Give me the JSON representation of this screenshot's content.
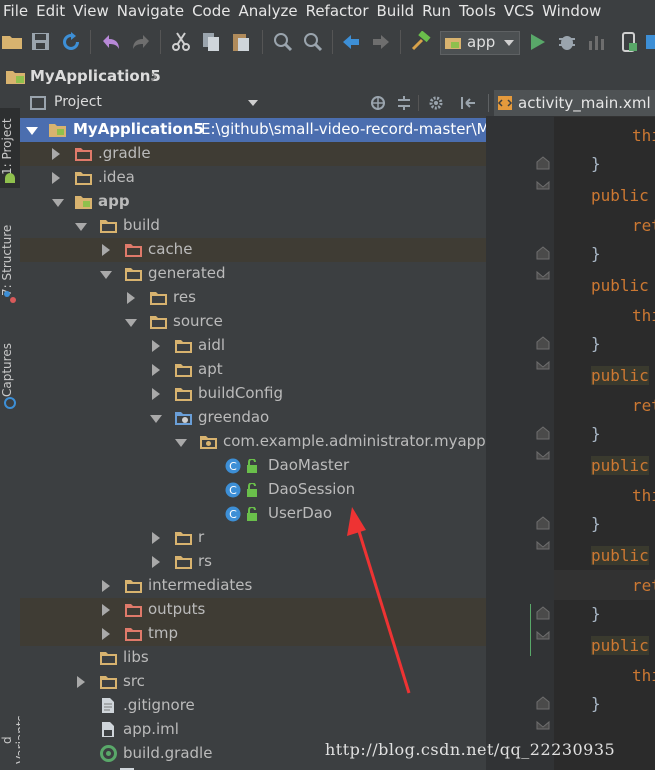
{
  "menubar": {
    "items": [
      "File",
      "Edit",
      "View",
      "Navigate",
      "Code",
      "Analyze",
      "Refactor",
      "Build",
      "Run",
      "Tools",
      "VCS",
      "Window"
    ]
  },
  "toolbar": {
    "run_config": "app"
  },
  "navbar": {
    "breadcrumb": "MyApplication5"
  },
  "sidebar": {
    "project_tab": "1: Project",
    "structure_tab": "7: Structure",
    "captures_tab": "Captures",
    "variants_tab": "d Variants"
  },
  "panel": {
    "title": "Project"
  },
  "tree": {
    "rows": [
      {
        "label": "MyApplication5",
        "path": "E:\\github\\small-video-record-master\\M",
        "icon": "module-folder-icon"
      },
      {
        "label": ".gradle",
        "icon": "folder-excluded-icon"
      },
      {
        "label": ".idea",
        "icon": "folder-icon"
      },
      {
        "label": "app",
        "icon": "module-folder-icon"
      },
      {
        "label": "build",
        "icon": "folder-icon"
      },
      {
        "label": "cache",
        "icon": "folder-excluded-icon"
      },
      {
        "label": "generated",
        "icon": "folder-icon"
      },
      {
        "label": "res",
        "icon": "folder-icon"
      },
      {
        "label": "source",
        "icon": "folder-icon"
      },
      {
        "label": "aidl",
        "icon": "folder-icon"
      },
      {
        "label": "apt",
        "icon": "folder-icon"
      },
      {
        "label": "buildConfig",
        "icon": "folder-icon"
      },
      {
        "label": "greendao",
        "icon": "source-folder-icon"
      },
      {
        "label": "com.example.administrator.myappli",
        "icon": "package-icon"
      },
      {
        "label": "DaoMaster",
        "icon": "class-icon"
      },
      {
        "label": "DaoSession",
        "icon": "class-icon"
      },
      {
        "label": "UserDao",
        "icon": "class-icon"
      },
      {
        "label": "r",
        "icon": "folder-icon"
      },
      {
        "label": "rs",
        "icon": "folder-icon"
      },
      {
        "label": "intermediates",
        "icon": "folder-icon"
      },
      {
        "label": "outputs",
        "icon": "folder-excluded-icon"
      },
      {
        "label": "tmp",
        "icon": "folder-excluded-icon"
      },
      {
        "label": "libs",
        "icon": "folder-icon"
      },
      {
        "label": "src",
        "icon": "folder-icon"
      },
      {
        "label": ".gitignore",
        "icon": "file-icon"
      },
      {
        "label": "app.iml",
        "icon": "file-icon"
      },
      {
        "label": "build.gradle",
        "icon": "gradle-icon"
      }
    ]
  },
  "editor": {
    "tab": "activity_main.xml",
    "lines": [
      "thi",
      "}",
      "public",
      "ret",
      "}",
      "public",
      "thi",
      "}",
      "public",
      "ret",
      "}",
      "public",
      "thi",
      "}",
      "public",
      "ret",
      "}",
      "public",
      "thi",
      "}"
    ]
  },
  "watermark": "http://blog.csdn.net/qq_22230935",
  "colors": {
    "selection": "#4b6eaf",
    "excluded_folder": "#e07a6a",
    "folder": "#d8b36f",
    "annotation_arrow": "#ee3333"
  }
}
